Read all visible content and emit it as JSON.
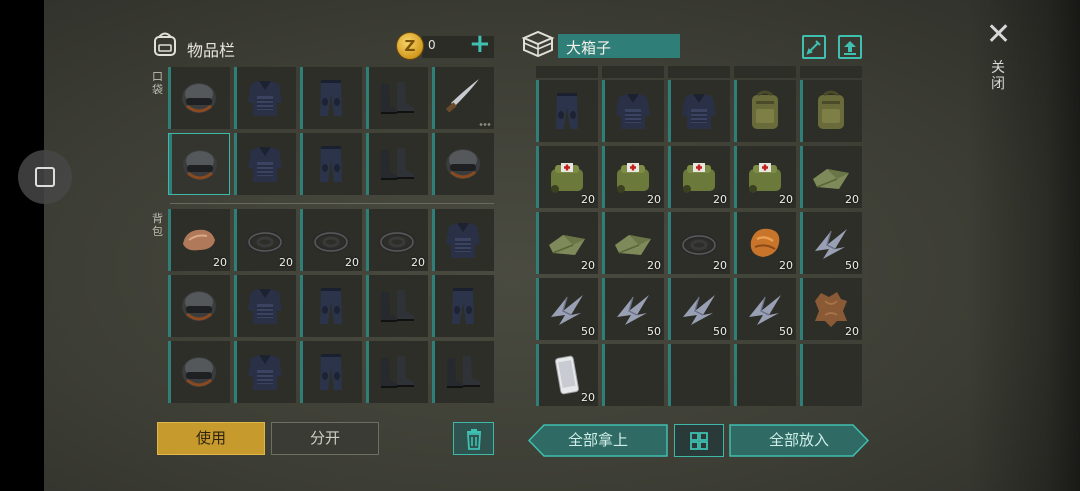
{
  "inventory": {
    "title": "物品栏",
    "coins": "0",
    "pocket_label": "口袋",
    "backpack_label": "背包",
    "pocket_slots": [
      {
        "item": "helmet-icon",
        "qty": ""
      },
      {
        "item": "vest-icon",
        "qty": ""
      },
      {
        "item": "pants-icon",
        "qty": ""
      },
      {
        "item": "boots-icon",
        "qty": ""
      },
      {
        "item": "machete-icon",
        "qty": ""
      },
      {
        "item": "helmet-icon",
        "qty": "",
        "selected": true
      },
      {
        "item": "vest-icon",
        "qty": ""
      },
      {
        "item": "pants-icon",
        "qty": ""
      },
      {
        "item": "boots-icon",
        "qty": ""
      },
      {
        "item": "helmet-icon",
        "qty": ""
      }
    ],
    "backpack_slots": [
      {
        "item": "stone-icon",
        "qty": "20"
      },
      {
        "item": "rope-icon",
        "qty": "20"
      },
      {
        "item": "rope-icon",
        "qty": "20"
      },
      {
        "item": "rope-icon",
        "qty": "20"
      },
      {
        "item": "vest-icon",
        "qty": ""
      },
      {
        "item": "helmet-icon",
        "qty": ""
      },
      {
        "item": "vest-icon",
        "qty": ""
      },
      {
        "item": "pants-icon",
        "qty": ""
      },
      {
        "item": "boots-icon",
        "qty": ""
      },
      {
        "item": "pants-icon",
        "qty": ""
      },
      {
        "item": "helmet-icon",
        "qty": ""
      },
      {
        "item": "vest-icon",
        "qty": ""
      },
      {
        "item": "pants-icon",
        "qty": ""
      },
      {
        "item": "boots-icon",
        "qty": ""
      },
      {
        "item": "boots-icon",
        "qty": ""
      }
    ]
  },
  "chest": {
    "name": "大箱子",
    "slots": [
      {
        "item": "pants-icon",
        "qty": ""
      },
      {
        "item": "vest-icon",
        "qty": ""
      },
      {
        "item": "vest-icon",
        "qty": ""
      },
      {
        "item": "backpack-icon",
        "qty": ""
      },
      {
        "item": "backpack-icon",
        "qty": ""
      },
      {
        "item": "medkit-icon",
        "qty": "20"
      },
      {
        "item": "medkit-icon",
        "qty": "20"
      },
      {
        "item": "medkit-icon",
        "qty": "20"
      },
      {
        "item": "medkit-icon",
        "qty": "20"
      },
      {
        "item": "cloth-icon",
        "qty": "20"
      },
      {
        "item": "cloth-icon",
        "qty": "20"
      },
      {
        "item": "cloth-icon",
        "qty": "20"
      },
      {
        "item": "rope-icon",
        "qty": "20"
      },
      {
        "item": "fur-icon",
        "qty": "20"
      },
      {
        "item": "metal-scrap-icon",
        "qty": "50"
      },
      {
        "item": "metal-scrap-icon",
        "qty": "50"
      },
      {
        "item": "metal-scrap-icon",
        "qty": "50"
      },
      {
        "item": "metal-scrap-icon",
        "qty": "50"
      },
      {
        "item": "metal-scrap-icon",
        "qty": "50"
      },
      {
        "item": "leather-icon",
        "qty": "20"
      },
      {
        "item": "phone-icon",
        "qty": "20"
      },
      {
        "item": "",
        "qty": ""
      },
      {
        "item": "",
        "qty": ""
      },
      {
        "item": "",
        "qty": ""
      },
      {
        "item": "",
        "qty": ""
      }
    ]
  },
  "buttons": {
    "use": "使用",
    "split": "分开",
    "take_all": "全部拿上",
    "put_all": "全部放入",
    "close": "关闭"
  },
  "colors": {
    "accent": "#3fb8aa",
    "use_button": "#c79a2e",
    "slot_bg": "#2d2e28"
  }
}
